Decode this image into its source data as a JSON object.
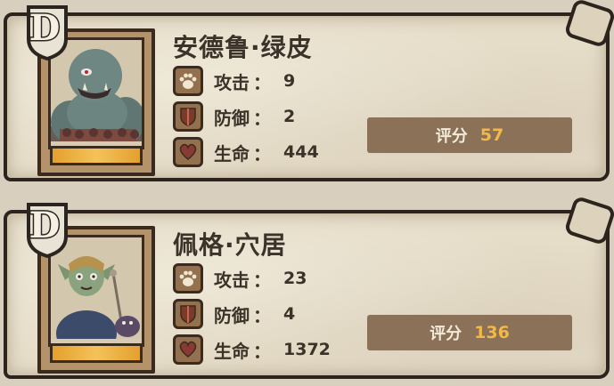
{
  "colors": {
    "parchment": "#e6ddc9",
    "outline": "#2c241d",
    "stat_icon_bg": "#93714f",
    "score_bar": "#8b7158",
    "score_value": "#f2b948",
    "gold_bar": "#f4c25a"
  },
  "heroes": [
    {
      "rank": "D",
      "name": "安德鲁·绿皮",
      "portrait": "orc-brute-portrait",
      "stats": {
        "attack": {
          "icon": "paw-icon",
          "label": "攻击",
          "value": "9"
        },
        "defense": {
          "icon": "shield-icon",
          "label": "防御",
          "value": "2"
        },
        "health": {
          "icon": "heart-icon",
          "label": "生命",
          "value": "444"
        }
      },
      "score": {
        "label": "评分",
        "value": "57"
      }
    },
    {
      "rank": "D",
      "name": "佩格·穴居",
      "portrait": "goblin-girl-portrait",
      "stats": {
        "attack": {
          "icon": "paw-icon",
          "label": "攻击",
          "value": "23"
        },
        "defense": {
          "icon": "shield-icon",
          "label": "防御",
          "value": "4"
        },
        "health": {
          "icon": "heart-icon",
          "label": "生命",
          "value": "1372"
        }
      },
      "score": {
        "label": "评分",
        "value": "136"
      }
    }
  ],
  "colon": "："
}
